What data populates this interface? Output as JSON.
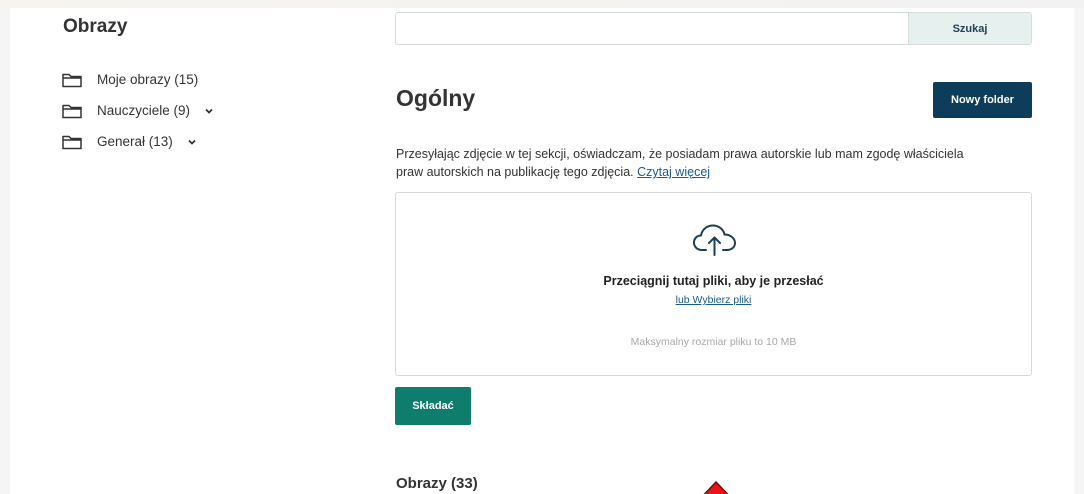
{
  "sidebar": {
    "title": "Obrazy",
    "folders": [
      {
        "label": "Moje obrazy (15)",
        "expandable": false
      },
      {
        "label": "Nauczyciele (9)",
        "expandable": true
      },
      {
        "label": "Generał (13)",
        "expandable": true
      }
    ]
  },
  "search": {
    "value": "",
    "placeholder": "",
    "button_label": "Szukaj"
  },
  "section": {
    "title": "Ogólny",
    "new_folder_label": "Nowy folder",
    "notice_text": "Przesyłając zdjęcie w tej sekcji, oświadczam, że posiadam prawa autorskie lub mam zgodę właściciela praw autorskich na publikację tego zdjęcia. ",
    "notice_link": "Czytaj więcej"
  },
  "upload": {
    "drop_title": "Przeciągnij tutaj pliki, aby je przesłać",
    "choose_link": "lub Wybierz pliki",
    "max_size_note": "Maksymalny rozmiar pliku to 10 MB",
    "submit_label": "Składać"
  },
  "images_heading": "Obrazy (33)",
  "colors": {
    "primary_dark": "#0e3d5c",
    "submit_green": "#0f7d6c",
    "search_button_bg": "#e6f1ef",
    "link": "#1a5a8a",
    "cursor_red": "#e8141a"
  }
}
